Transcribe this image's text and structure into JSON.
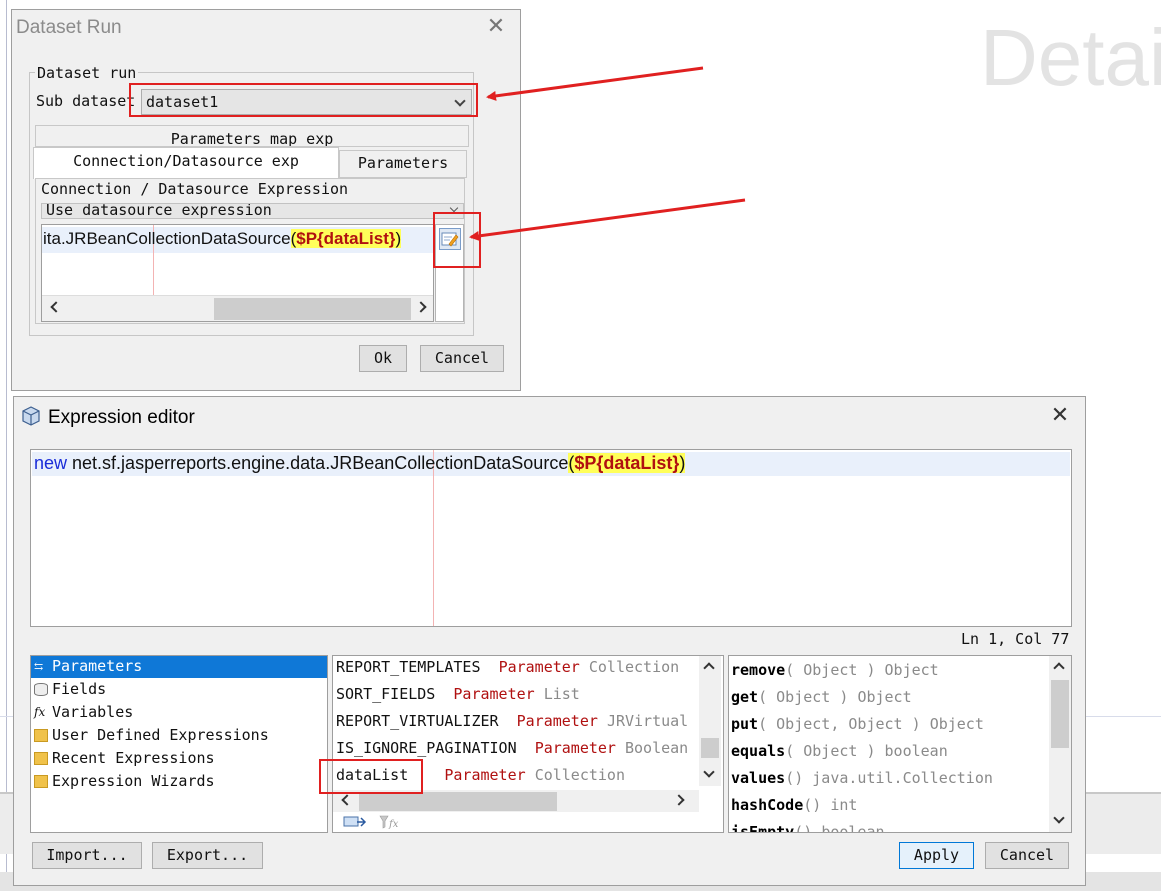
{
  "background": {
    "heading": "Detai"
  },
  "dataset_run": {
    "title": "Dataset Run",
    "group_legend": "Dataset run",
    "sub_dataset_label": "Sub dataset",
    "sub_dataset_value": "dataset1",
    "tabs": {
      "params_map": "Parameters map exp",
      "connection": "Connection/Datasource exp",
      "parameters": "Parameters"
    },
    "connection_label": "Connection / Datasource Expression",
    "connection_type": "Use datasource expression",
    "expression": {
      "class_part": "ita.JRBeanCollectionDataSource",
      "open_paren": "(",
      "param": "$P{dataList}",
      "close_paren": ")"
    },
    "ok_label": "Ok",
    "cancel_label": "Cancel"
  },
  "expression_editor": {
    "title": "Expression editor",
    "code": {
      "keyword": "new",
      "class_name": " net.sf.jasperreports.engine.data.JRBeanCollectionDataSource",
      "open_paren": "(",
      "param": "$P{dataList}",
      "close_paren": ")"
    },
    "cursor_position": "Ln 1, Col 77",
    "categories": [
      {
        "icon": "parameters-icon",
        "label": "Parameters",
        "selected": true
      },
      {
        "icon": "fields-icon",
        "label": "Fields",
        "selected": false
      },
      {
        "icon": "variables-icon",
        "label": "Variables",
        "selected": false
      },
      {
        "icon": "folder-icon",
        "label": "User Defined Expressions",
        "selected": false
      },
      {
        "icon": "folder-icon",
        "label": "Recent Expressions",
        "selected": false
      },
      {
        "icon": "folder-icon",
        "label": "Expression Wizards",
        "selected": false
      }
    ],
    "objects": [
      {
        "name": "REPORT_TEMPLATES",
        "kind": "Parameter",
        "type": "Collection"
      },
      {
        "name": "SORT_FIELDS",
        "kind": "Parameter",
        "type": "List"
      },
      {
        "name": "REPORT_VIRTUALIZER",
        "kind": "Parameter",
        "type": "JRVirtual"
      },
      {
        "name": "IS_IGNORE_PAGINATION",
        "kind": "Parameter",
        "type": "Boolean"
      },
      {
        "name": "dataList",
        "kind": "Parameter",
        "type": "Collection"
      }
    ],
    "methods": [
      {
        "name": "remove",
        "args": "( Object )",
        "ret": "Object"
      },
      {
        "name": "get",
        "args": "( Object )",
        "ret": "Object"
      },
      {
        "name": "put",
        "args": "( Object, Object )",
        "ret": "Object"
      },
      {
        "name": "equals",
        "args": "( Object )",
        "ret": "boolean"
      },
      {
        "name": "values",
        "args": "()",
        "ret": "java.util.Collection"
      },
      {
        "name": "hashCode",
        "args": "()",
        "ret": "int"
      },
      {
        "name": "isEmpty",
        "args": "()",
        "ret": "boolean"
      }
    ],
    "import_label": "Import...",
    "export_label": "Export...",
    "apply_label": "Apply",
    "cancel_label": "Cancel"
  },
  "colors": {
    "annotation": "#e02020",
    "selection": "#0f78d7",
    "keyword": "#1a2cd8",
    "param": "#b01010",
    "param_highlight": "#ffff5a"
  }
}
